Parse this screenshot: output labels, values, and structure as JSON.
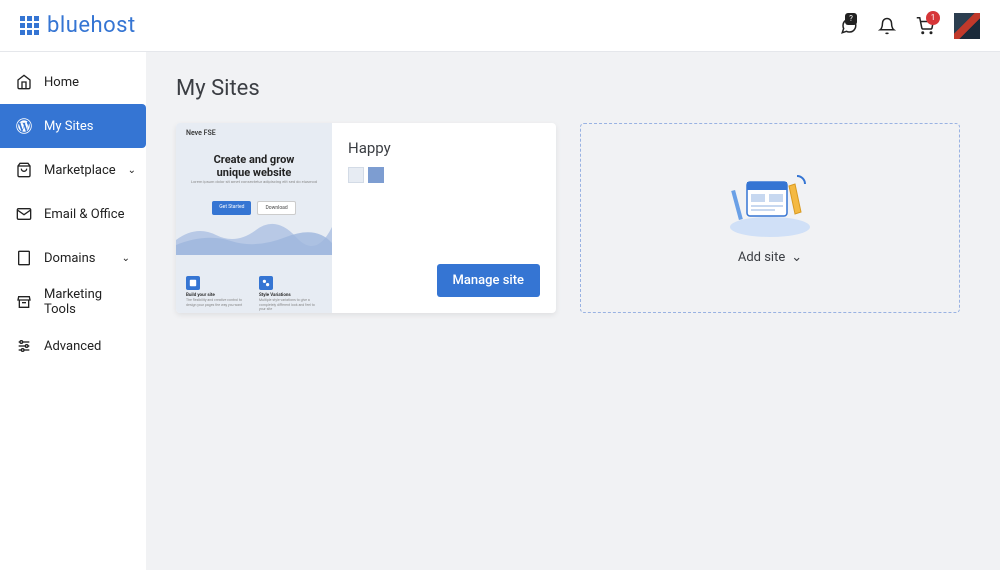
{
  "brand": "bluehost",
  "badges": {
    "chat": "?",
    "cart": "1"
  },
  "nav": {
    "home": "Home",
    "mysites": "My Sites",
    "marketplace": "Marketplace",
    "email": "Email & Office",
    "domains": "Domains",
    "marketing": "Marketing Tools",
    "advanced": "Advanced"
  },
  "page_title": "My Sites",
  "site": {
    "name": "Happy",
    "preview": {
      "theme": "Neve FSE",
      "headline1": "Create and grow",
      "headline2": "unique website",
      "cta_primary": "Get Started",
      "cta_secondary": "Download",
      "feat1": "Build your site",
      "feat1_sub": "The flexibility and creative control to design your pages the way you want",
      "feat2": "Style Variations",
      "feat2_sub": "Multiple style variations to give a completely different look and feel to your site"
    },
    "manage_label": "Manage site"
  },
  "add_site_label": "Add site"
}
